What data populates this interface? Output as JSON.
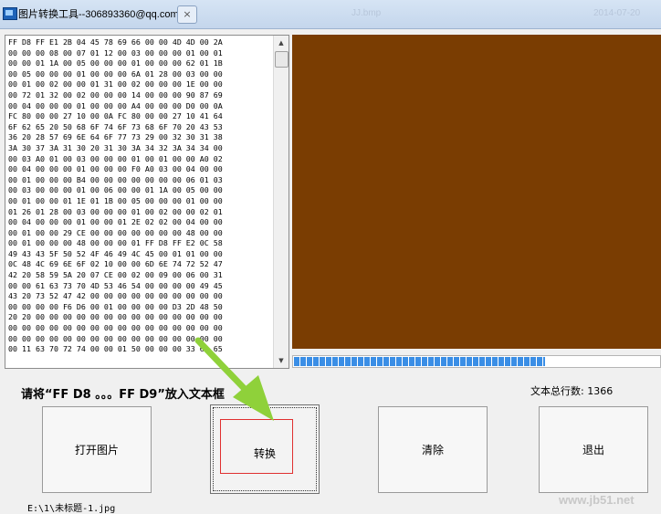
{
  "window": {
    "title": "图片转换工具--306893360@qq.com",
    "close_glyph": "×",
    "bg_text_1": "JJ.bmp",
    "bg_text_2": "2014-07-20"
  },
  "hex_dump": [
    "FF D8 FF E1 2B 04 45 78 69 66 00 00 4D 4D 00 2A",
    "00 00 00 08 00 07 01 12 00 03 00 00 00 01 00 01",
    "00 00 01 1A 00 05 00 00 00 01 00 00 00 62 01 1B",
    "00 05 00 00 00 01 00 00 00 6A 01 28 00 03 00 00",
    "00 01 00 02 00 00 01 31 00 02 00 00 00 1E 00 00",
    "00 72 01 32 00 02 00 00 00 14 00 00 00 90 87 69",
    "00 04 00 00 00 01 00 00 00 A4 00 00 00 D0 00 0A",
    "FC 80 00 00 27 10 00 0A FC 80 00 00 27 10 41 64",
    "6F 62 65 20 50 68 6F 74 6F 73 68 6F 70 20 43 53",
    "36 20 28 57 69 6E 64 6F 77 73 29 00 32 30 31 38",
    "3A 30 37 3A 31 30 20 31 30 3A 34 32 3A 34 34 00",
    "00 03 A0 01 00 03 00 00 00 01 00 01 00 00 A0 02",
    "00 04 00 00 00 01 00 00 00 F0 A0 03 00 04 00 00",
    "00 01 00 00 00 B4 00 00 00 00 00 00 00 06 01 03",
    "00 03 00 00 00 01 00 06 00 00 01 1A 00 05 00 00",
    "00 01 00 00 01 1E 01 1B 00 05 00 00 00 01 00 00",
    "01 26 01 28 00 03 00 00 00 01 00 02 00 00 02 01",
    "00 04 00 00 00 01 00 00 01 2E 02 02 00 04 00 00",
    "00 01 00 00 29 CE 00 00 00 00 00 00 00 48 00 00",
    "00 01 00 00 00 48 00 00 00 01 FF D8 FF E2 0C 58",
    "49 43 43 5F 50 52 4F 46 49 4C 45 00 01 01 00 00",
    "0C 48 4C 69 6E 6F 02 10 00 00 6D 6E 74 72 52 47",
    "42 20 58 59 5A 20 07 CE 00 02 00 09 00 06 00 31",
    "00 00 61 63 73 70 4D 53 46 54 00 00 00 00 49 45",
    "43 20 73 52 47 42 00 00 00 00 00 00 00 00 00 00",
    "00 00 00 00 F6 D6 00 01 00 00 00 00 D3 2D 48 50",
    "20 20 00 00 00 00 00 00 00 00 00 00 00 00 00 00",
    "00 00 00 00 00 00 00 00 00 00 00 00 00 00 00 00",
    "00 00 00 00 00 00 00 00 00 00 00 00 00 00 00 00",
    "00 11 63 70 72 74 00 00 01 50 00 00 00 33 64 65"
  ],
  "preview_color": "#7a3d02",
  "progress_percent": 69,
  "instruction": "请将“FF D8 。。。FF D9”放入文本框",
  "line_count": {
    "label": "文本总行数:",
    "value": "1366"
  },
  "buttons": {
    "open": "打开图片",
    "convert": "转换",
    "clear": "清除",
    "exit": "退出"
  },
  "file_path": "E:\\1\\未标题-1.jpg",
  "watermark": "www.jb51.net"
}
